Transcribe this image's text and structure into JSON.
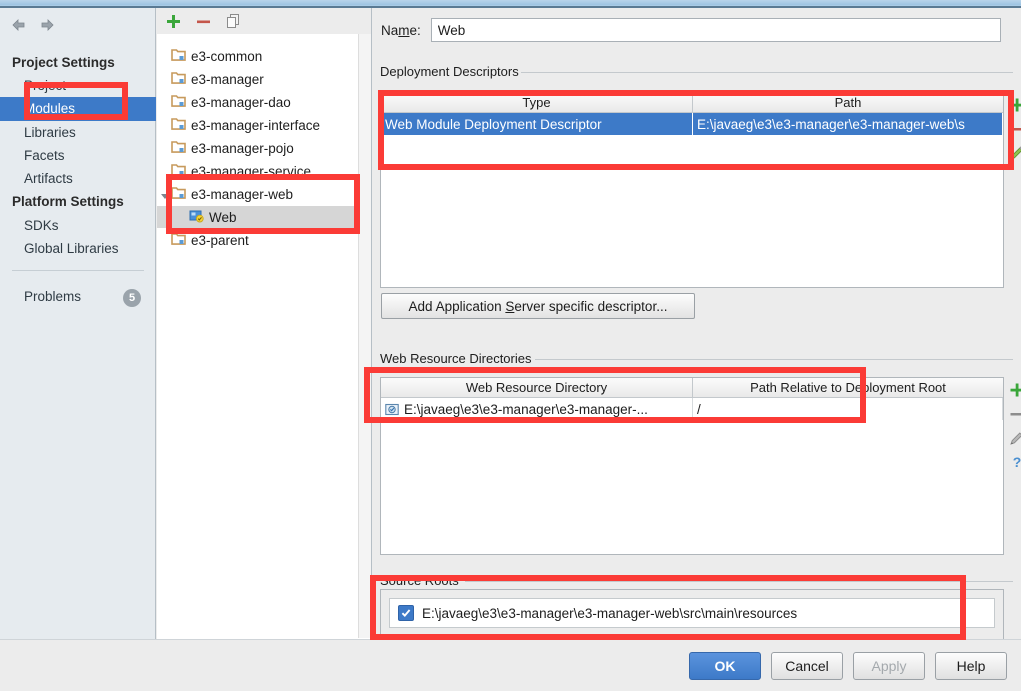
{
  "window": {
    "nav_back_icon": "arrow-left-icon",
    "nav_forward_icon": "arrow-right-icon"
  },
  "sidebar": {
    "groups": [
      {
        "label": "Project Settings"
      },
      {
        "label": "Platform Settings"
      }
    ],
    "project_settings_items": [
      {
        "label": "Project",
        "selected": false
      },
      {
        "label": "Modules",
        "selected": true
      },
      {
        "label": "Libraries",
        "selected": false
      },
      {
        "label": "Facets",
        "selected": false
      },
      {
        "label": "Artifacts",
        "selected": false
      }
    ],
    "platform_settings_items": [
      {
        "label": "SDKs",
        "selected": false
      },
      {
        "label": "Global Libraries",
        "selected": false
      }
    ],
    "problems": {
      "label": "Problems",
      "count": "5"
    }
  },
  "tree": {
    "toolbar": [
      {
        "name": "add-module-button",
        "icon": "plus-icon"
      },
      {
        "name": "remove-module-button",
        "icon": "minus-icon"
      },
      {
        "name": "copy-module-button",
        "icon": "copy-icon"
      }
    ],
    "items": [
      {
        "label": "e3-common",
        "icon": "module-folder-icon",
        "type": "module",
        "selected": false
      },
      {
        "label": "e3-manager",
        "icon": "module-folder-icon",
        "type": "module",
        "selected": false
      },
      {
        "label": "e3-manager-dao",
        "icon": "module-folder-icon",
        "type": "module",
        "selected": false
      },
      {
        "label": "e3-manager-interface",
        "icon": "module-folder-icon",
        "type": "module",
        "selected": false
      },
      {
        "label": "e3-manager-pojo",
        "icon": "module-folder-icon",
        "type": "module",
        "selected": false
      },
      {
        "label": "e3-manager-service",
        "icon": "module-folder-icon",
        "type": "module",
        "selected": false
      },
      {
        "label": "e3-manager-web",
        "icon": "module-folder-icon",
        "type": "module",
        "selected": false,
        "expanded": true
      },
      {
        "label": "Web",
        "icon": "web-facet-icon",
        "type": "facet",
        "selected": true
      },
      {
        "label": "e3-parent",
        "icon": "module-folder-icon",
        "type": "module",
        "selected": false
      }
    ]
  },
  "main": {
    "name_field": {
      "label": "Name:",
      "label_mnemonic": "m",
      "value": "Web"
    },
    "deployment_descriptors": {
      "title": "Deployment Descriptors",
      "columns": [
        "Type",
        "Path"
      ],
      "rows": [
        {
          "type": "Web Module Deployment Descriptor",
          "path": "E:\\javaeg\\e3\\e3-manager\\e3-manager-web\\s",
          "selected": true
        }
      ],
      "toolbar": [
        {
          "name": "add-descriptor-button",
          "icon": "plus-icon"
        },
        {
          "name": "remove-descriptor-button",
          "icon": "minus-icon"
        },
        {
          "name": "edit-descriptor-button",
          "icon": "pencil-icon"
        }
      ]
    },
    "add_app_server_button": {
      "label_before": "Add Application ",
      "label_mnemonic": "S",
      "label_after": "erver specific descriptor..."
    },
    "web_resource_directories": {
      "title": "Web Resource Directories",
      "columns": [
        "Web Resource Directory",
        "Path Relative to Deployment Root"
      ],
      "rows": [
        {
          "directory": "E:\\javaeg\\e3\\e3-manager\\e3-manager-...",
          "relative_path": "/",
          "icon": "folder-web-icon"
        }
      ],
      "toolbar": [
        {
          "name": "add-web-resource-button",
          "icon": "plus-icon"
        },
        {
          "name": "remove-web-resource-button",
          "icon": "minus-icon"
        },
        {
          "name": "edit-web-resource-button",
          "icon": "pencil-icon"
        },
        {
          "name": "help-web-resource-button",
          "icon": "question-icon"
        }
      ]
    },
    "source_roots": {
      "title": "Source Roots",
      "rows": [
        {
          "path": "E:\\javaeg\\e3\\e3-manager\\e3-manager-web\\src\\main\\resources",
          "checked": true
        }
      ]
    }
  },
  "footer": {
    "ok": "OK",
    "cancel": "Cancel",
    "apply": "Apply",
    "help": "Help"
  },
  "annotations": {
    "color": "#fb3b36",
    "boxes": [
      {
        "name": "annotation-modules"
      },
      {
        "name": "annotation-module-web-tree"
      },
      {
        "name": "annotation-deployment-descriptors"
      },
      {
        "name": "annotation-web-resource-directories"
      },
      {
        "name": "annotation-source-roots"
      }
    ]
  }
}
